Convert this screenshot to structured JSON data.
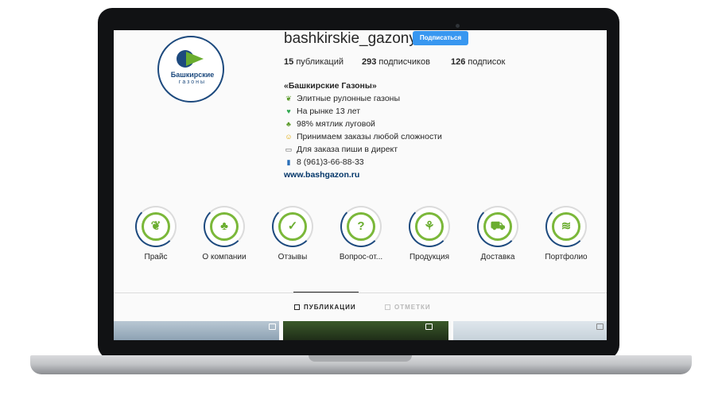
{
  "profile": {
    "username": "bashkirskie_gazony",
    "follow_label": "Подписаться",
    "logo_text": "Башкирские",
    "logo_sub": "газоны",
    "stats": {
      "posts_count": "15",
      "posts_label": "публикаций",
      "followers_count": "293",
      "followers_label": "подписчиков",
      "following_count": "126",
      "following_label": "подписок"
    },
    "bio": {
      "name": "«Башкирские Газоны»",
      "lines": [
        {
          "icon": "leaf-icon",
          "text": "Элитные рулонные газоны"
        },
        {
          "icon": "green-heart-icon",
          "text": "На рынке 13 лет"
        },
        {
          "icon": "sprout-icon",
          "text": "98% мятлик луговой"
        },
        {
          "icon": "smile-icon",
          "text": "Принимаем заказы любой сложности"
        },
        {
          "icon": "inbox-icon",
          "text": "Для заказа пиши в директ"
        },
        {
          "icon": "phone-icon",
          "text": "8 (961)3-66-88-33"
        }
      ],
      "link": "www.bashgazon.ru"
    }
  },
  "highlights": [
    {
      "label": "Прайс",
      "icon": "leaf-icon"
    },
    {
      "label": "О компании",
      "icon": "plant-hands-icon"
    },
    {
      "label": "Отзывы",
      "icon": "checkmark-icon"
    },
    {
      "label": "Вопрос-от...",
      "icon": "question-icon"
    },
    {
      "label": "Продукция",
      "icon": "wheat-icon"
    },
    {
      "label": "Доставка",
      "icon": "tractor-icon"
    },
    {
      "label": "Портфолио",
      "icon": "lawn-icon"
    }
  ],
  "tabs": {
    "posts": "ПУБЛИКАЦИИ",
    "tagged": "ОТМЕТКИ"
  },
  "colors": {
    "accent_green": "#7bb83a",
    "brand_blue": "#1d4a7e",
    "follow_blue": "#3897f0"
  }
}
